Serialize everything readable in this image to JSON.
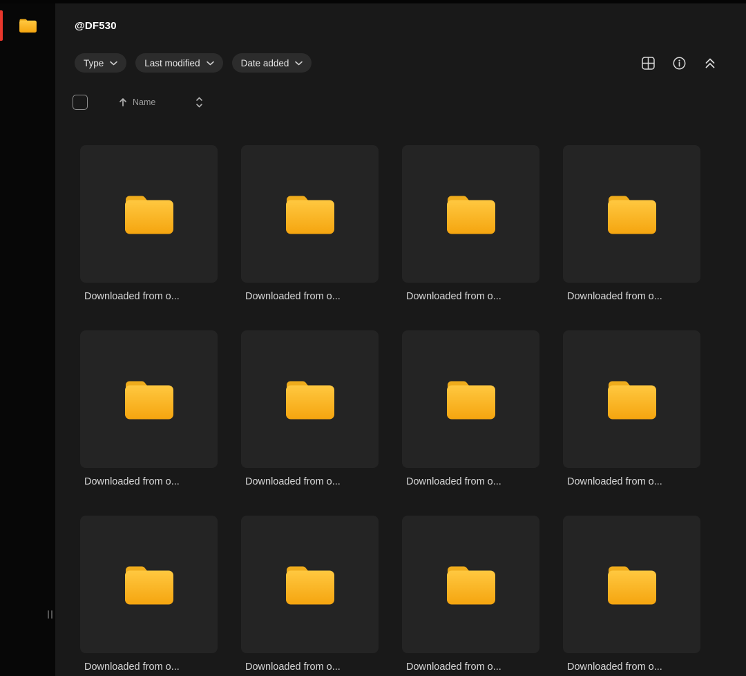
{
  "window": {
    "title": "@DF530"
  },
  "sidebar": {
    "active_item": {
      "name": "folder-shortcut",
      "icon": "folder-icon"
    },
    "accent_color": "#e8372c"
  },
  "toolbar": {
    "filters": [
      {
        "label": "Type"
      },
      {
        "label": "Last modified"
      },
      {
        "label": "Date added"
      }
    ],
    "view_actions": [
      {
        "name": "grid-view",
        "icon": "grid-view-icon"
      },
      {
        "name": "info",
        "icon": "info-icon"
      },
      {
        "name": "collapse",
        "icon": "double-chevron-up-icon"
      }
    ]
  },
  "list_controls": {
    "select_all_checked": false,
    "sort_label": "Name",
    "sort_direction": "ascending"
  },
  "grid": {
    "items": [
      {
        "type": "folder",
        "label": "Downloaded from o..."
      },
      {
        "type": "folder",
        "label": "Downloaded from o..."
      },
      {
        "type": "folder",
        "label": "Downloaded from o..."
      },
      {
        "type": "folder",
        "label": "Downloaded from o..."
      },
      {
        "type": "folder",
        "label": "Downloaded from o..."
      },
      {
        "type": "folder",
        "label": "Downloaded from o..."
      },
      {
        "type": "folder",
        "label": "Downloaded from o..."
      },
      {
        "type": "folder",
        "label": "Downloaded from o..."
      },
      {
        "type": "folder",
        "label": "Downloaded from o..."
      },
      {
        "type": "folder",
        "label": "Downloaded from o..."
      },
      {
        "type": "folder",
        "label": "Downloaded from o..."
      },
      {
        "type": "folder",
        "label": "Downloaded from o..."
      }
    ]
  },
  "colors": {
    "background": "#191919",
    "sidebar": "#070707",
    "tile": "#242424",
    "chip": "#2c2c2c",
    "accent_red": "#e8372c",
    "folder_top": "#ffc840",
    "folder_bottom": "#f5a50f"
  }
}
